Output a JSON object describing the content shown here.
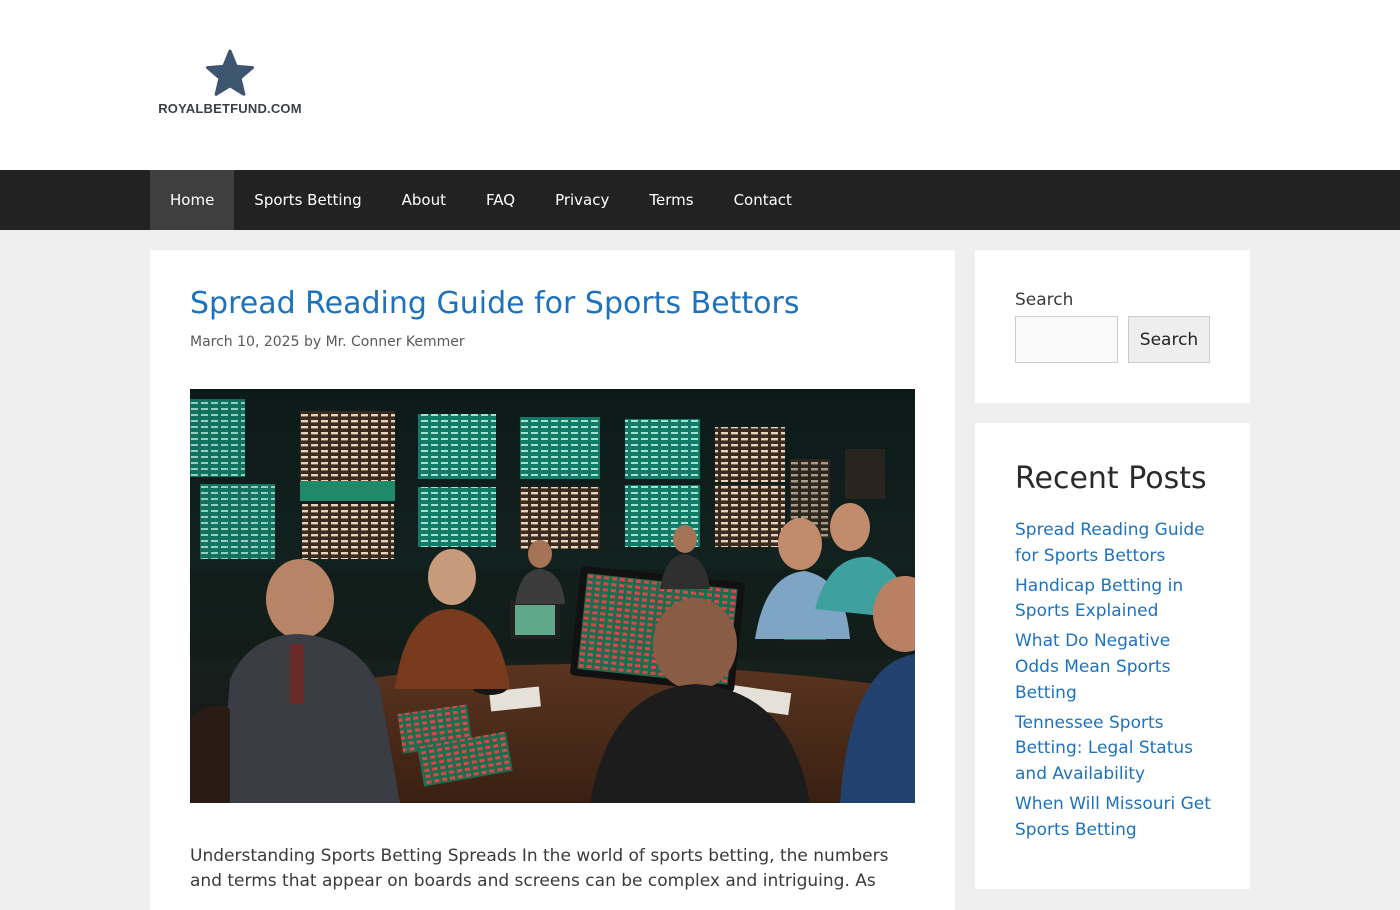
{
  "site": {
    "logo_text": "ROYALBETFUND.COM",
    "logo_icon": "star-icon",
    "brand_color": "#3e5570"
  },
  "nav": {
    "items": [
      {
        "label": "Home",
        "active": true
      },
      {
        "label": "Sports Betting"
      },
      {
        "label": "About"
      },
      {
        "label": "FAQ"
      },
      {
        "label": "Privacy"
      },
      {
        "label": "Terms"
      },
      {
        "label": "Contact"
      }
    ]
  },
  "post": {
    "title": "Spread Reading Guide for Sports Bettors",
    "date": "March 10, 2025",
    "by": "by",
    "author": "Mr. Conner Kemmer",
    "excerpt": "Understanding Sports Betting Spreads In the world of sports betting, the numbers and terms that appear on boards and screens can be complex and intriguing. As"
  },
  "sidebar": {
    "search": {
      "label": "Search",
      "input_value": "",
      "button_label": "Search"
    },
    "recent": {
      "heading": "Recent Posts",
      "items": [
        "Spread Reading Guide for Sports Bettors",
        "Handicap Betting in Sports Explained",
        "What Do Negative Odds Mean Sports Betting",
        "Tennessee Sports Betting: Legal Status and Availability",
        "When Will Missouri Get Sports Betting"
      ]
    }
  },
  "colors": {
    "link": "#1e72bd",
    "nav_bg": "#222222",
    "nav_active": "#3f3f3f",
    "page_bg": "#efefef"
  }
}
